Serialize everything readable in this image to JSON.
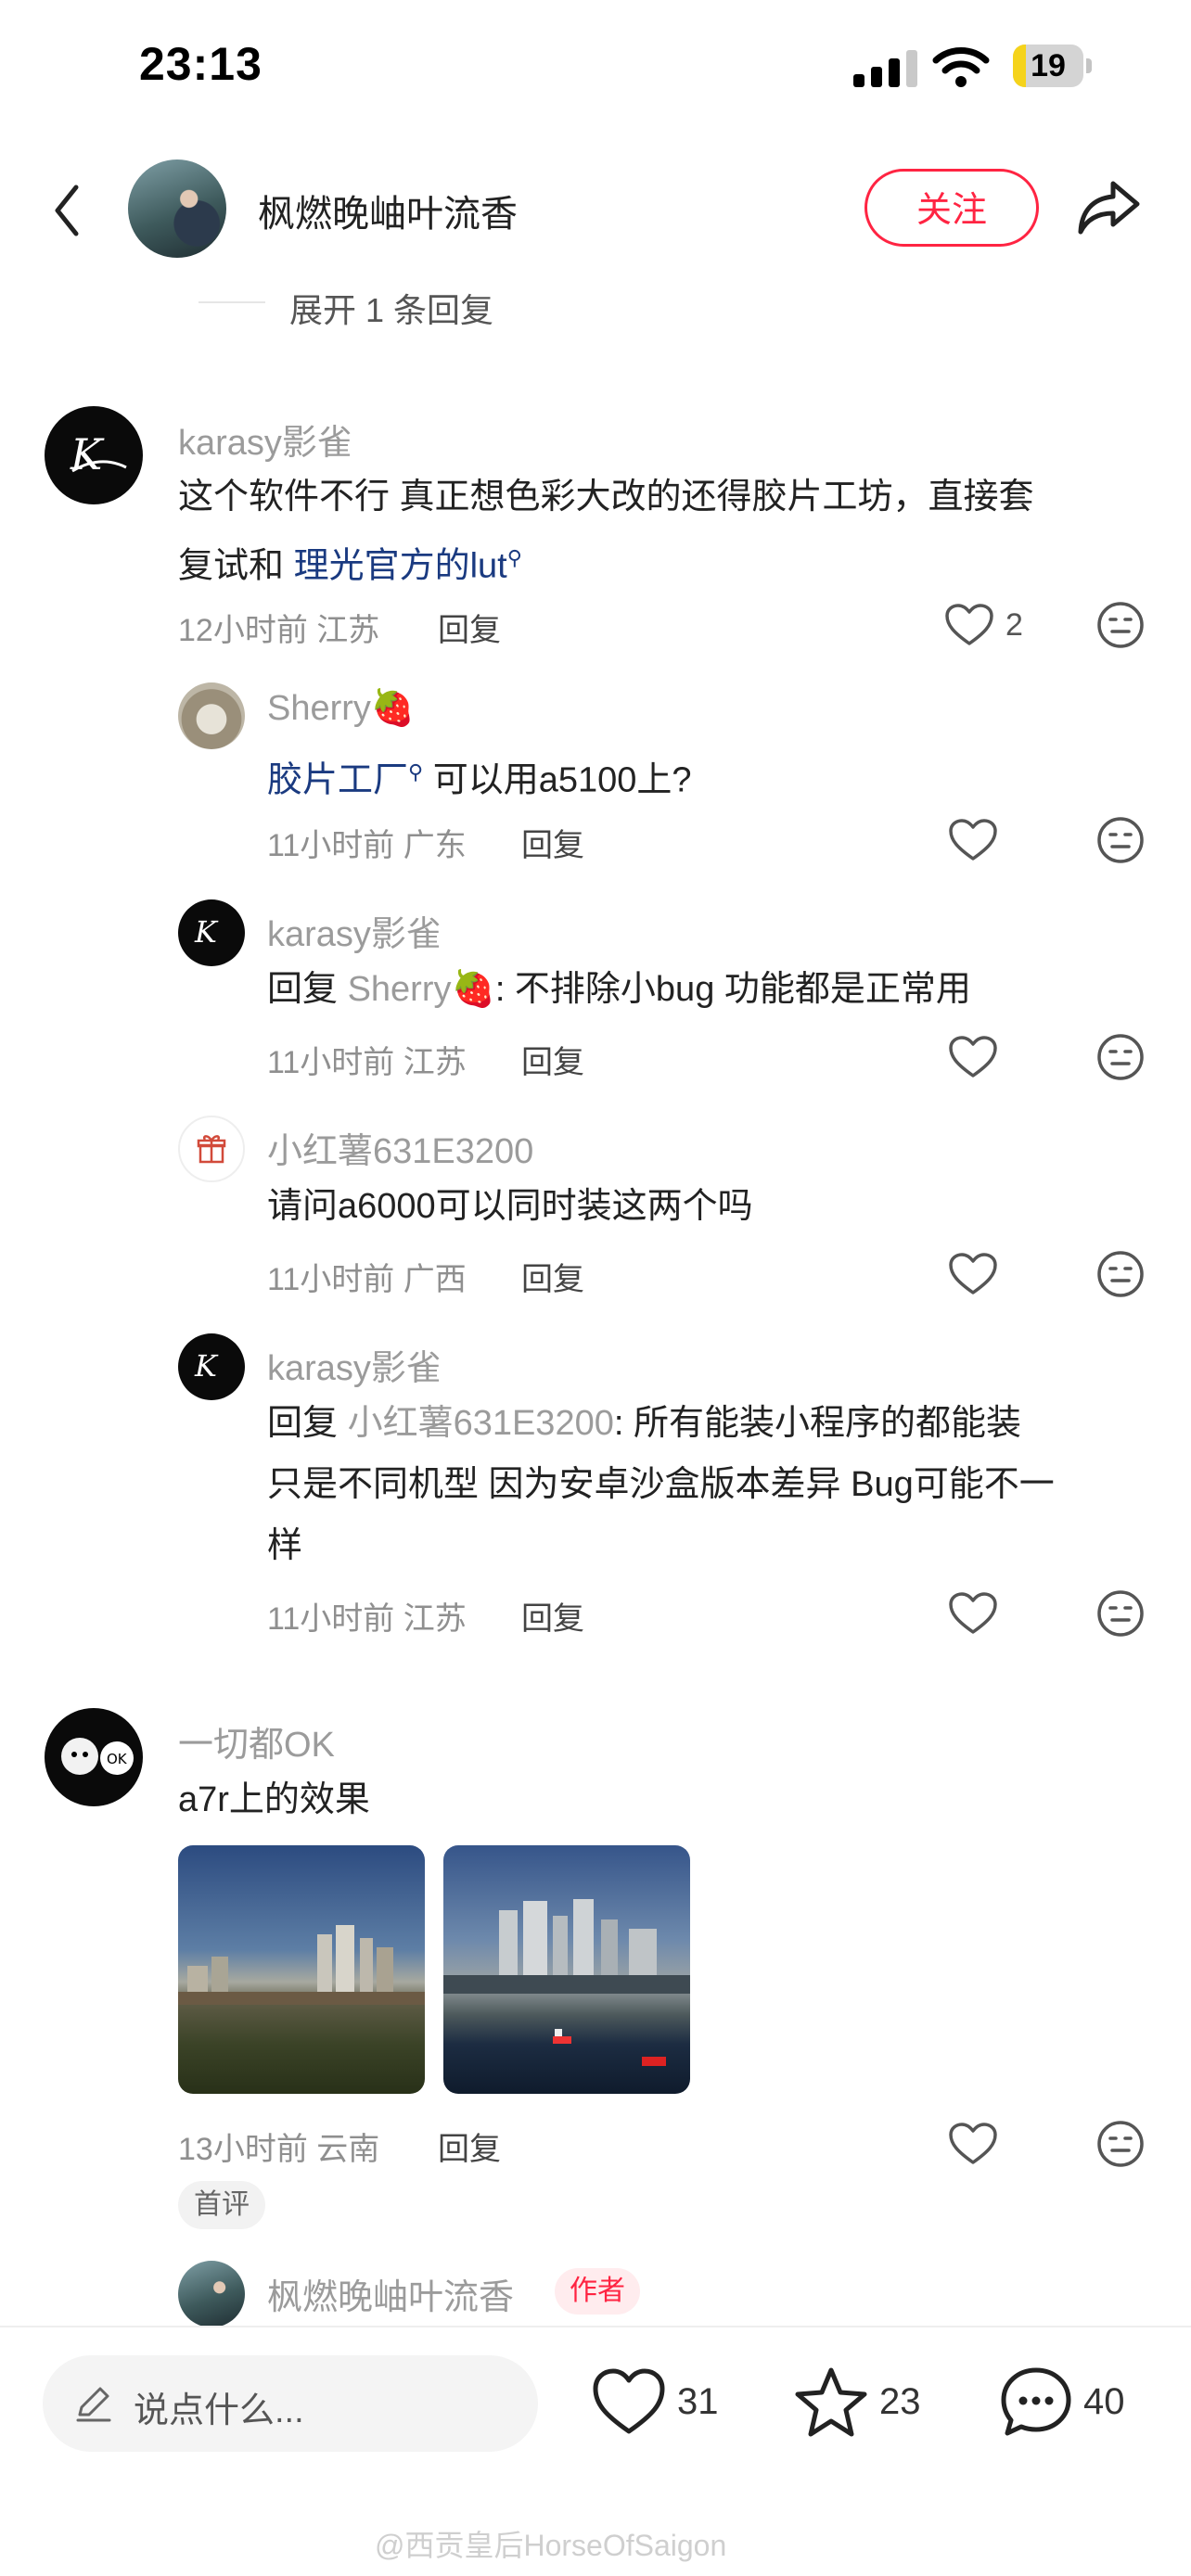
{
  "status_bar": {
    "time": "23:13",
    "battery": "19",
    "battery_level": 0.19
  },
  "header": {
    "title": "枫燃晚岫叶流香",
    "follow_label": "关注"
  },
  "expand_replies": "展开 1 条回复",
  "comments": [
    {
      "user": "karasy影雀",
      "text_lines": [
        "这个软件不行 真正想色彩大改的还得胶片工坊，直接套",
        "复试和 "
      ],
      "link_text": "理光官方的lut",
      "time_location": "12小时前 江苏",
      "reply_label": "回复",
      "likes": "2",
      "replies": [
        {
          "user": "Sherry🍓",
          "link_text": "胶片工厂",
          "text": " 可以用a5100上?",
          "time_location": "11小时前 广东",
          "reply_label": "回复"
        },
        {
          "user": "karasy影雀",
          "reply_prefix": "回复 ",
          "reply_to": "Sherry🍓",
          "text": ": 不排除小bug 功能都是正常用",
          "time_location": "11小时前 江苏",
          "reply_label": "回复"
        },
        {
          "user": "小红薯631E3200",
          "text": "请问a6000可以同时装这两个吗",
          "time_location": "11小时前 广西",
          "reply_label": "回复"
        },
        {
          "user": "karasy影雀",
          "reply_prefix": "回复 ",
          "reply_to": "小红薯631E3200",
          "text_first": ": 所有能装小程序的都能装",
          "text_lines": [
            "只是不同机型 因为安卓沙盒版本差异 Bug可能不一",
            "样"
          ],
          "time_location": "11小时前 江苏",
          "reply_label": "回复"
        }
      ]
    },
    {
      "user": "一切都OK",
      "text": "a7r上的效果",
      "time_location": "13小时前 云南",
      "reply_label": "回复",
      "first_badge": "首评",
      "avatar_badge": "OK",
      "author_reply": {
        "user": "枫燃晚岫叶流香",
        "tag": "作者"
      }
    }
  ],
  "bottom_bar": {
    "input_placeholder": "说点什么...",
    "likes": "31",
    "stars": "23",
    "comments": "40"
  },
  "watermark": "@西贡皇后HorseOfSaigon",
  "colors": {
    "accent": "#ff2442",
    "link": "#1a3a80",
    "battery": "#f5d31b"
  }
}
